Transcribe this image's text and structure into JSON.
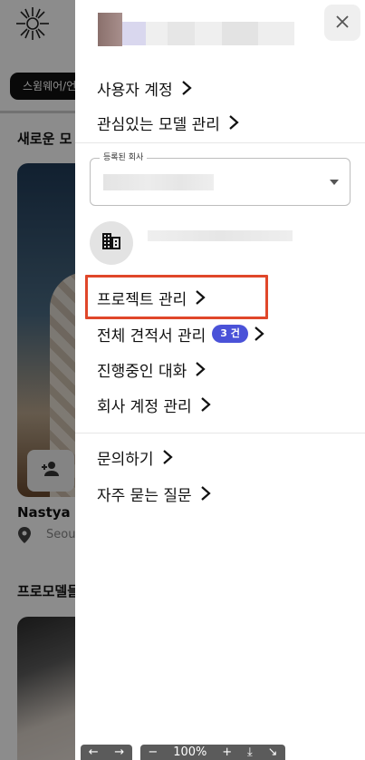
{
  "background": {
    "filter_chip": "스윔웨어/언",
    "section_new_models": "새로운 모",
    "model_name": "Nastya",
    "model_location": "Seou",
    "section_pro_models": "프로모델들"
  },
  "drawer": {
    "links_top": [
      {
        "label": "사용자 계정"
      },
      {
        "label": "관심있는 모델 관리"
      }
    ],
    "company_select": {
      "label": "등록된 회사"
    },
    "company_links": [
      {
        "label": "프로젝트 관리",
        "highlighted": true
      },
      {
        "label": "전체 견적서 관리",
        "badge": "3 건"
      },
      {
        "label": "진행중인 대화"
      },
      {
        "label": "회사 계정 관리"
      }
    ],
    "support_links": [
      {
        "label": "문의하기"
      },
      {
        "label": "자주 묻는 질문"
      }
    ]
  },
  "toolbar": {
    "back": "←",
    "forward": "→",
    "zoom_out": "−",
    "zoom": "100%",
    "zoom_in": "+",
    "download": "⤓",
    "collapse": "↘"
  },
  "colors": {
    "accent_badge": "#4a52d8",
    "highlight_border": "#e0472a"
  }
}
